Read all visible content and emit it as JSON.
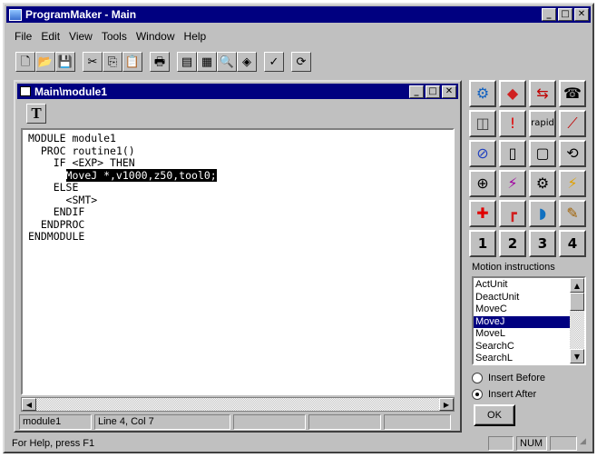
{
  "app": {
    "title": "ProgramMaker - Main"
  },
  "window_buttons": {
    "minimize": "_",
    "maximize": "□",
    "close": "✕"
  },
  "menu": [
    "File",
    "Edit",
    "View",
    "Tools",
    "Window",
    "Help"
  ],
  "toolbar": {
    "icons": [
      "new-file-icon",
      "open-folder-icon",
      "save-disk-icon",
      "cut-scissors-icon",
      "copy-icon",
      "paste-icon",
      "print-icon",
      "properties-icon",
      "table-icon",
      "find-icon",
      "cube-icon",
      "check-icon",
      "refresh-icon"
    ],
    "glyphs": [
      "🗋",
      "📂",
      "💾",
      "✂",
      "⎘",
      "📋",
      "🖶",
      "▤",
      "▦",
      "🔍",
      "◈",
      "✓",
      "⟳"
    ]
  },
  "child_window": {
    "title": "Main\\module1",
    "text_tool_label": "T",
    "code_lines": [
      {
        "indent": "",
        "text": "MODULE module1",
        "selected": false
      },
      {
        "indent": "  ",
        "text": "PROC routine1()",
        "selected": false
      },
      {
        "indent": "    ",
        "text": "IF <EXP> THEN",
        "selected": false
      },
      {
        "indent": "      ",
        "text": "MoveJ *,v1000,z50,tool0;",
        "selected": true
      },
      {
        "indent": "    ",
        "text": "ELSE",
        "selected": false
      },
      {
        "indent": "      ",
        "text": "<SMT>",
        "selected": false
      },
      {
        "indent": "    ",
        "text": "ENDIF",
        "selected": false
      },
      {
        "indent": "  ",
        "text": "ENDPROC",
        "selected": false
      },
      {
        "indent": "",
        "text": "ENDMODULE",
        "selected": false
      }
    ],
    "status": {
      "module": "module1",
      "line_col": "Line  4, Col  7"
    }
  },
  "instruction_palette": {
    "buttons": [
      {
        "name": "motion-icon",
        "glyph": "⚙",
        "color": "#1060c0"
      },
      {
        "name": "shapes-icon",
        "glyph": "◆",
        "color": "#d02020"
      },
      {
        "name": "arrows-icon",
        "glyph": "⇆",
        "color": "#c00000"
      },
      {
        "name": "phone-icon",
        "glyph": "☎",
        "color": "#000000"
      },
      {
        "name": "layers-icon",
        "glyph": "◫",
        "color": "#404040"
      },
      {
        "name": "exclamation-icon",
        "glyph": "!",
        "color": "#e00000"
      },
      {
        "name": "rapid-icon",
        "glyph": "rapid",
        "color": "#000000"
      },
      {
        "name": "graph-icon",
        "glyph": "⟋",
        "color": "#c00000"
      },
      {
        "name": "crossed-circle-icon",
        "glyph": "⊘",
        "color": "#2040c0"
      },
      {
        "name": "device-icon",
        "glyph": "▯",
        "color": "#000000"
      },
      {
        "name": "bracket-icon",
        "glyph": "▢",
        "color": "#000000"
      },
      {
        "name": "cycle-icon",
        "glyph": "⟲",
        "color": "#000000"
      },
      {
        "name": "target-icon",
        "glyph": "⊕",
        "color": "#000000"
      },
      {
        "name": "gear-lightning-icon",
        "glyph": "⚡",
        "color": "#a000a0"
      },
      {
        "name": "gears-icon",
        "glyph": "⚙",
        "color": "#000000"
      },
      {
        "name": "spark-icon",
        "glyph": "⚡",
        "color": "#e0a000"
      },
      {
        "name": "add-cross-icon",
        "glyph": "✚",
        "color": "#e00000"
      },
      {
        "name": "robot-arm-icon",
        "glyph": "┏",
        "color": "#d02020"
      },
      {
        "name": "drill-icon",
        "glyph": "◗",
        "color": "#1070c0"
      },
      {
        "name": "pencil-icon",
        "glyph": "✎",
        "color": "#a06000"
      },
      {
        "name": "num-1-icon",
        "glyph": "1",
        "color": "#000000"
      },
      {
        "name": "num-2-icon",
        "glyph": "2",
        "color": "#000000"
      },
      {
        "name": "num-3-icon",
        "glyph": "3",
        "color": "#000000"
      },
      {
        "name": "num-4-icon",
        "glyph": "4",
        "color": "#000000"
      }
    ],
    "label": "Motion instructions",
    "list_items": [
      "ActUnit",
      "DeactUnit",
      "MoveC",
      "MoveJ",
      "MoveL",
      "SearchC",
      "SearchL"
    ],
    "selected_index": 3,
    "radio_insert_before": "Insert Before",
    "radio_insert_after": "Insert After",
    "radio_selected": "after",
    "ok_label": "OK"
  },
  "statusbar": {
    "message": "For Help, press F1",
    "num": "NUM"
  }
}
